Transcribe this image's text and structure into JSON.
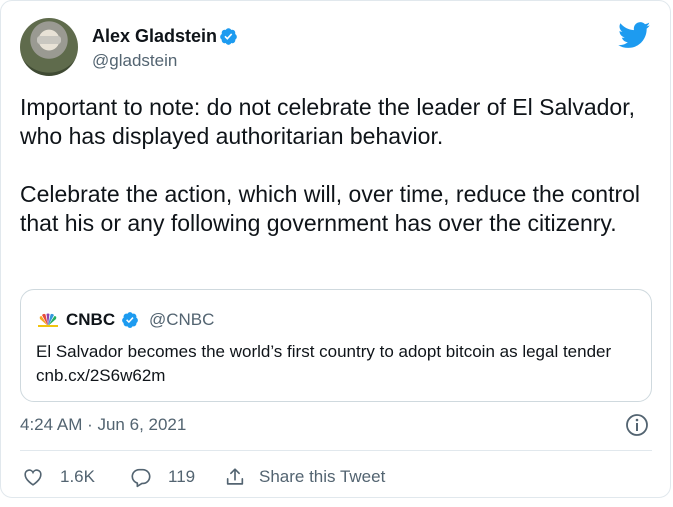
{
  "author": {
    "name": "Alex Gladstein",
    "handle": "@gladstein",
    "verified": true
  },
  "tweet": {
    "paragraphs": [
      "Important to note: do not celebrate the leader of El Salvador, who has displayed authoritarian behavior.",
      "Celebrate the action, which will, over time, reduce the control that his or any following government has over the citizenry."
    ],
    "timestamp": "4:24 AM · Jun 6, 2021"
  },
  "quoted": {
    "name": "CNBC",
    "handle": "@CNBC",
    "verified": true,
    "text": "El Salvador becomes the world’s first country to adopt bitcoin as legal tender cnb.cx/2S6w62m"
  },
  "actions": {
    "likes": "1.6K",
    "replies": "119",
    "share_label": "Share this Tweet"
  },
  "icons": {
    "brand": "twitter-bird-icon",
    "verified": "verified-badge-icon",
    "like": "heart-icon",
    "reply": "reply-bubble-icon",
    "share": "share-upload-icon",
    "info": "info-icon"
  },
  "colors": {
    "brand_blue": "#1d9bf0",
    "text_primary": "#0f1419",
    "text_secondary": "#536471",
    "border": "#cfd9de"
  }
}
